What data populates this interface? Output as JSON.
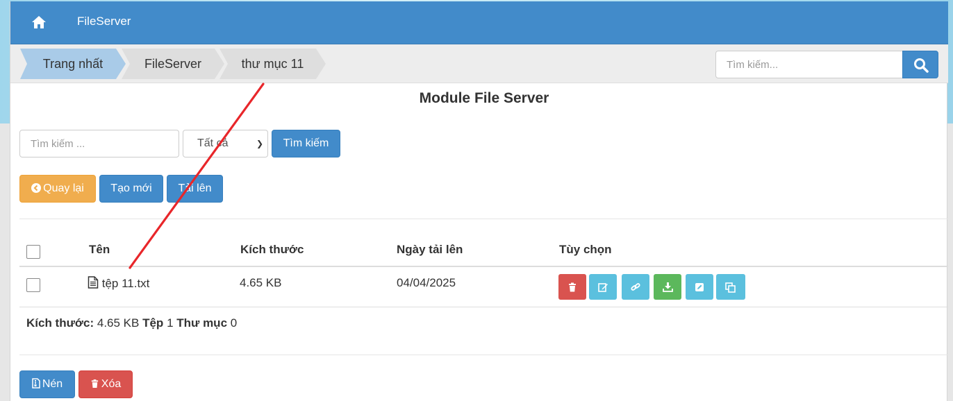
{
  "topbar": {
    "brand": "FileServer",
    "home_icon": "home-icon"
  },
  "breadcrumb": {
    "items": [
      {
        "label": "Trang nhất"
      },
      {
        "label": "FileServer"
      },
      {
        "label": "thư mục 11"
      }
    ]
  },
  "top_search": {
    "placeholder": "Tìm kiếm...",
    "icon": "search-icon"
  },
  "page_title": "Module File Server",
  "filter": {
    "input_placeholder": "Tìm kiếm ...",
    "select_value": "Tất cả",
    "search_button": "Tìm kiếm"
  },
  "toolbar": {
    "back_label": "Quay lại",
    "create_label": "Tạo mới",
    "upload_label": "Tải lên"
  },
  "table": {
    "headers": {
      "name": "Tên",
      "size": "Kích thước",
      "date": "Ngày tải lên",
      "options": "Tùy chọn"
    },
    "rows": [
      {
        "name": "tệp 11.txt",
        "size": "4.65 KB",
        "date": "04/04/2025",
        "actions": [
          "trash-icon",
          "edit-icon",
          "link-icon",
          "download-icon",
          "rename-icon",
          "copy-icon"
        ]
      }
    ]
  },
  "summary": {
    "size_label": "Kích thước:",
    "size_value": "4.65 KB",
    "files_label": "Tệp",
    "files_value": "1",
    "folders_label": "Thư mục",
    "folders_value": "0"
  },
  "bottom": {
    "compress_label": "Nén",
    "delete_label": "Xóa"
  },
  "colors": {
    "primary": "#428bca",
    "warning": "#f0ad4e",
    "danger": "#d9534f",
    "info": "#5bc0de",
    "success": "#5cb85c",
    "annotation": "#e8262a"
  }
}
